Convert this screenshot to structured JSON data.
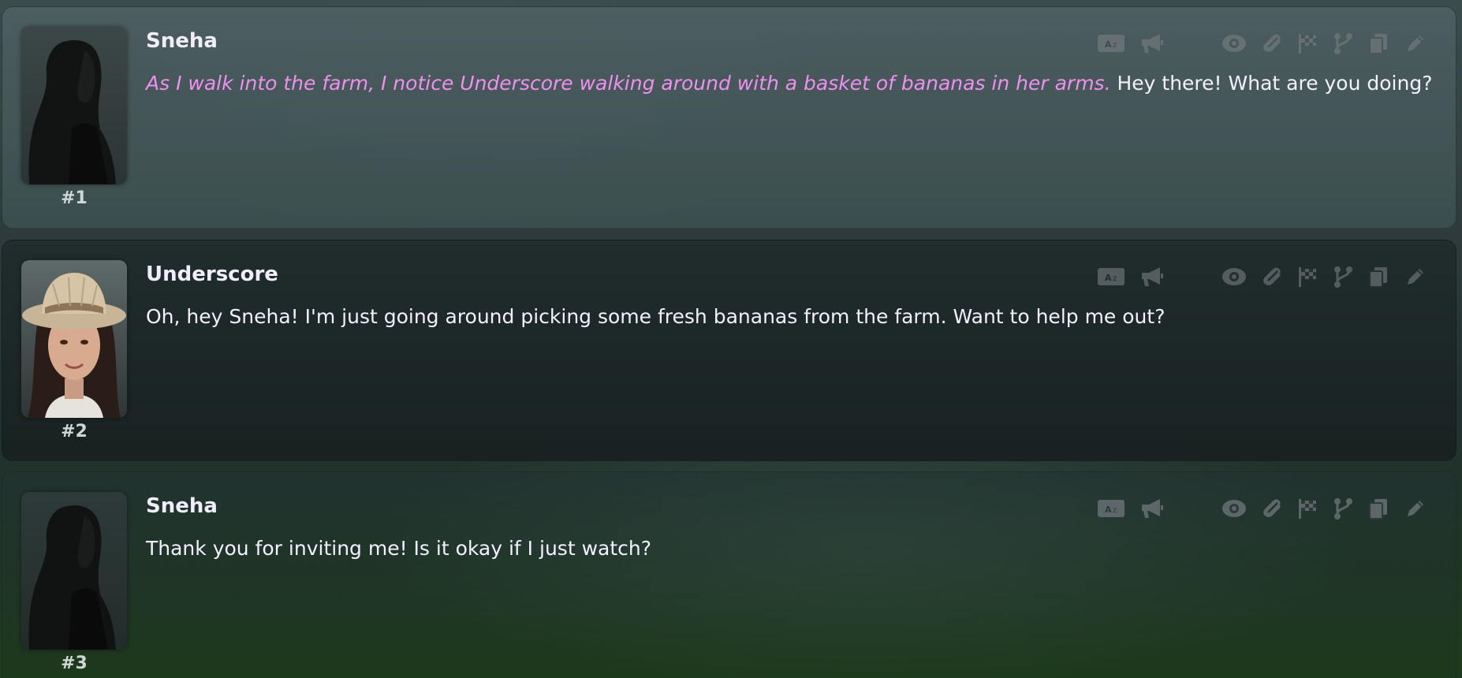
{
  "messages": [
    {
      "id_label": "#1",
      "name": "Sneha",
      "action": "As I walk into the farm, I notice Underscore walking around with a basket of bananas in her arms.",
      "speech": " Hey there! What are you doing?",
      "avatar": "silhouette-woman"
    },
    {
      "id_label": "#2",
      "name": "Underscore",
      "action": "",
      "speech": "Oh, hey Sneha! I'm just going around picking some fresh bananas from the farm. Want to help me out?",
      "avatar": "woman-cowboy-hat"
    },
    {
      "id_label": "#3",
      "name": "Sneha",
      "action": "",
      "speech": "Thank you for inviting me! Is it okay if I just watch?",
      "avatar": "silhouette-woman"
    }
  ],
  "message_buttons": [
    "translate-icon",
    "narrate-icon",
    "eye-icon",
    "paperclip-icon",
    "checkered-flag-icon",
    "branch-icon",
    "copy-icon",
    "pencil-icon"
  ],
  "colors": {
    "action_text": "#ef8ff0",
    "message_text": "#f3f0ff",
    "icon": "#666f72"
  }
}
